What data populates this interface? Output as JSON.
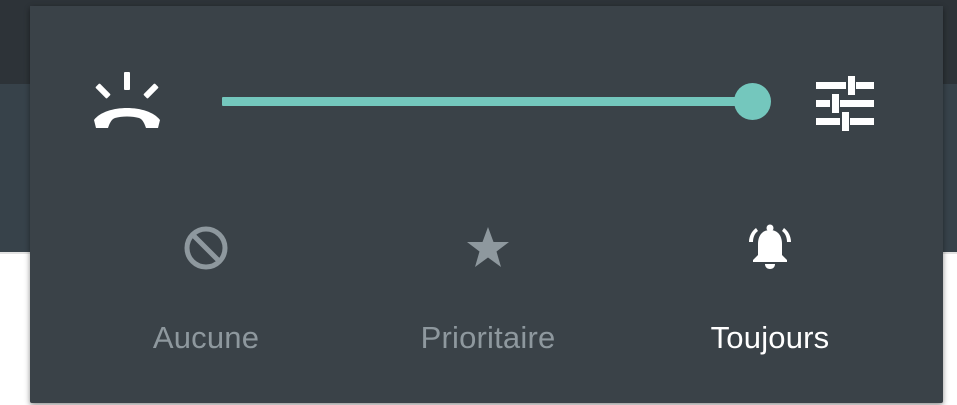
{
  "volume": {
    "level_fraction": 1.0
  },
  "icons": {
    "ringer": "phone-ringing-icon",
    "settings": "tune-sliders-icon"
  },
  "modes": [
    {
      "label": "Aucune",
      "icon": "no-sign-icon",
      "selected": false
    },
    {
      "label": "Prioritaire",
      "icon": "star-icon",
      "selected": false
    },
    {
      "label": "Toujours",
      "icon": "bell-ringing-icon",
      "selected": true
    }
  ],
  "colors": {
    "panel": "#3a4248",
    "accent": "#74c7bd",
    "text_selected": "#ffffff",
    "text_unselected": "#8e989e"
  }
}
